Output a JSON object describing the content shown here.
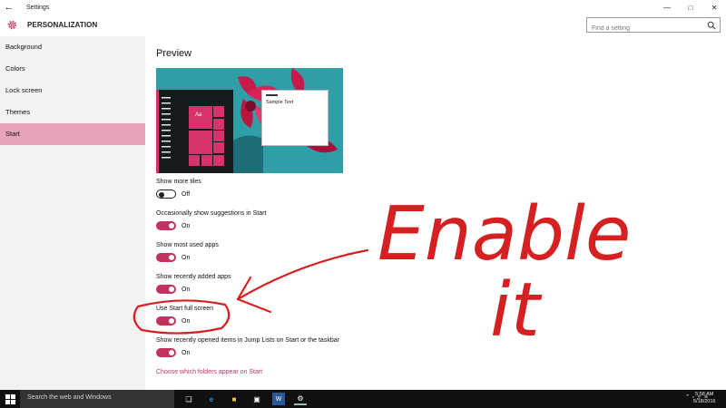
{
  "window": {
    "title": "Settings",
    "back_icon": "back-arrow-icon",
    "controls": [
      "minimize-icon",
      "maximize-icon",
      "close-icon"
    ]
  },
  "header": {
    "title": "PERSONALIZATION",
    "icon": "gear-icon",
    "search_placeholder": "Find a setting"
  },
  "sidebar": {
    "items": [
      {
        "label": "Background"
      },
      {
        "label": "Colors"
      },
      {
        "label": "Lock screen"
      },
      {
        "label": "Themes"
      },
      {
        "label": "Start",
        "selected": true
      }
    ]
  },
  "main": {
    "preview_title": "Preview",
    "preview": {
      "tile_label": "Aa",
      "sample_text": "Sample Text"
    },
    "settings": [
      {
        "label": "Show more tiles",
        "state": "Off"
      },
      {
        "label": "Occasionally show suggestions in Start",
        "state": "On"
      },
      {
        "label": "Show most used apps",
        "state": "On"
      },
      {
        "label": "Show recently added apps",
        "state": "On"
      },
      {
        "label": "Use Start full screen",
        "state": "On"
      },
      {
        "label": "Show recently opened items in Jump Lists on Start or the taskbar",
        "state": "On"
      }
    ],
    "folders_link": "Choose which folders appear on Start"
  },
  "annotation": {
    "text_line1": "Enable",
    "text_line2": "it",
    "color": "#d42020"
  },
  "taskbar": {
    "search_placeholder": "Search the web and Windows",
    "time": "5:58 AM",
    "date": "5/18/2016"
  },
  "colors": {
    "accent": "#c1335e",
    "sidebar_selected": "#e6a3bc"
  }
}
